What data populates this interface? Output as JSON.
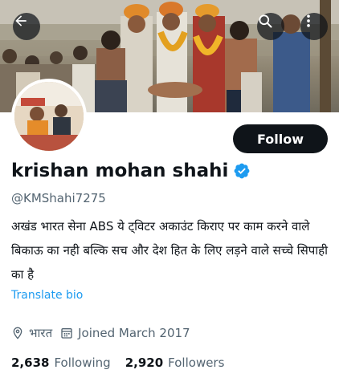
{
  "header": {
    "back_icon": "arrow-left-icon",
    "search_icon": "search-icon",
    "more_icon": "more-vertical-icon"
  },
  "profile": {
    "display_name": "krishan mohan shahi",
    "verified_icon": "verified-badge-icon",
    "verified_color": "#1d9bf0",
    "handle": "@KMShahi7275",
    "bio": "अखंड भारत सेना ABS ये ट्विटर अकाउंट किराए पर काम करने वाले बिकाऊ का नही बल्कि सच और देश हित के लिए लड़ने वाले सच्चे सिपाही का है",
    "translate_label": "Translate bio",
    "location_icon": "location-pin-icon",
    "location": "भारत",
    "joined_icon": "calendar-icon",
    "joined": "Joined March 2017"
  },
  "actions": {
    "follow_label": "Follow"
  },
  "stats": {
    "following_count": "2,638",
    "following_label": "Following",
    "followers_count": "2,920",
    "followers_label": "Followers"
  },
  "colors": {
    "accent": "#1d9bf0",
    "primary_button": "#0f1419",
    "secondary_text": "#536471"
  }
}
